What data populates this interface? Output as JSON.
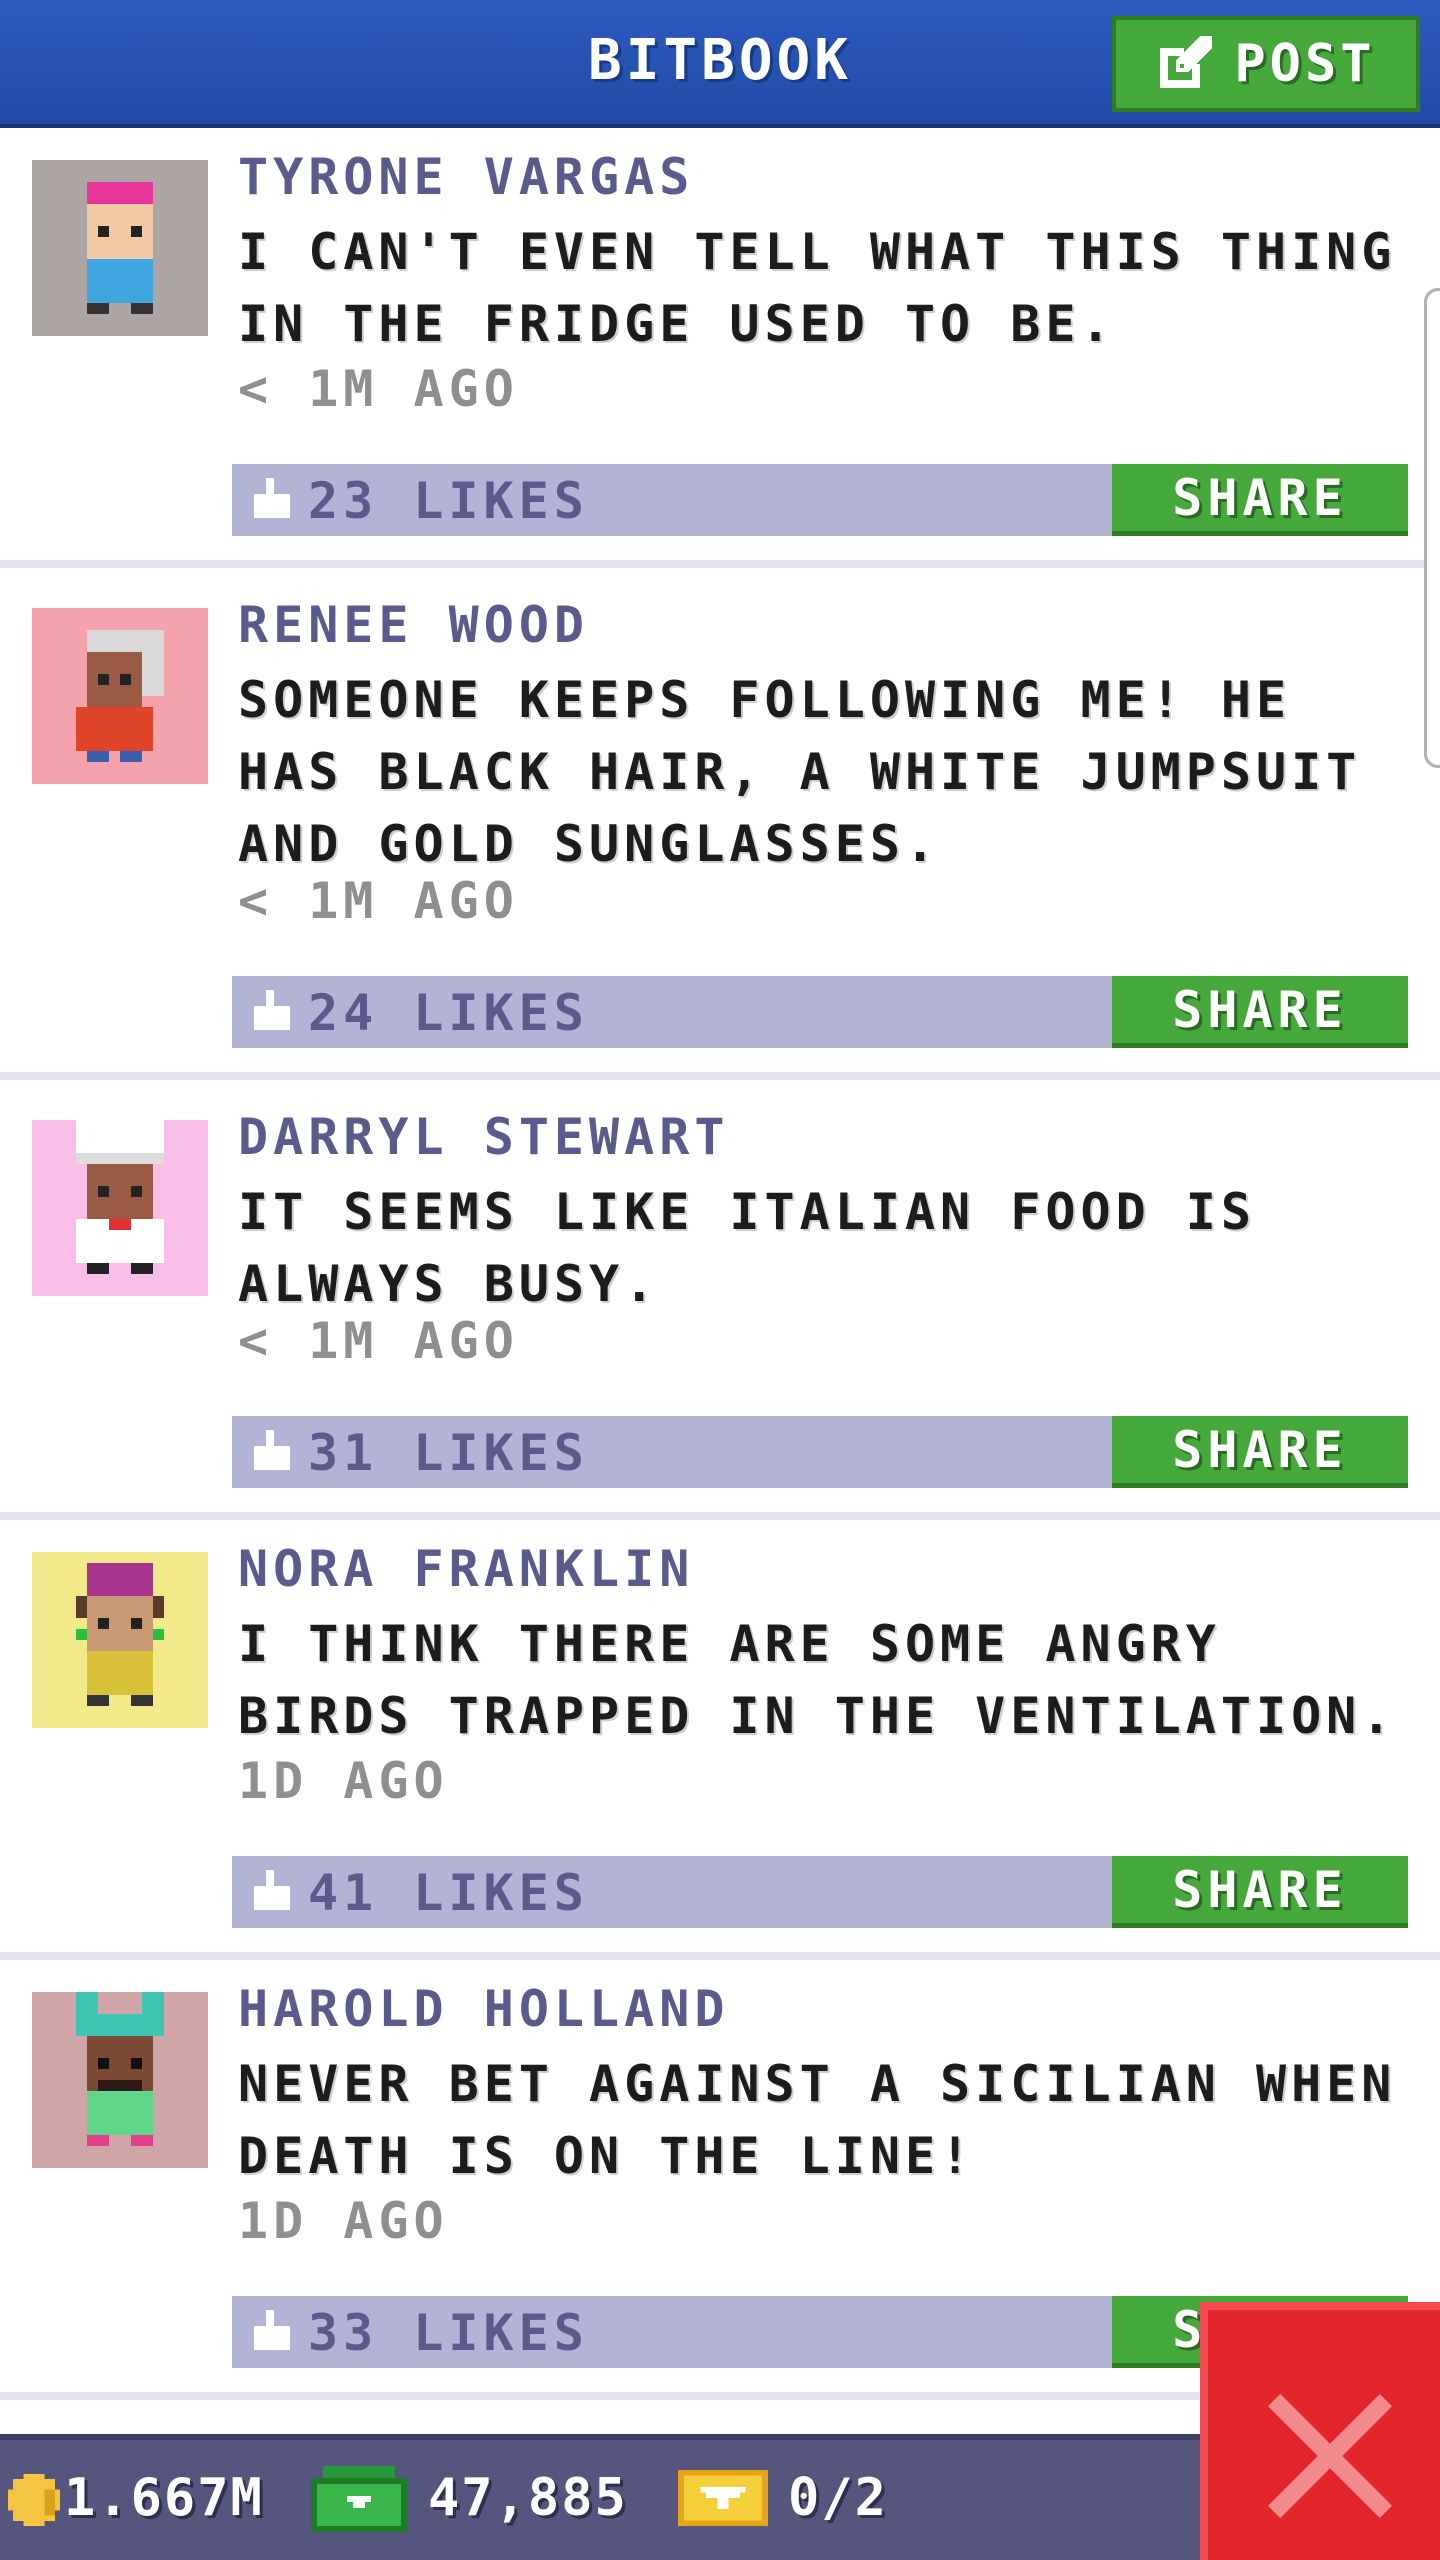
{
  "header": {
    "title": "BITBOOK",
    "post_label": "POST"
  },
  "posts": [
    {
      "author": "TYRONE VARGAS",
      "message": "I CAN'T EVEN TELL WHAT THIS THING IN THE FRIDGE USED TO BE.",
      "time": "< 1M AGO",
      "likes": "23 LIKES",
      "share_label": "SHARE",
      "avatar_bg": "#aca5a3",
      "hair": "#e8369b",
      "shirt": "#3fa6e0",
      "skin": "#f2c9a4"
    },
    {
      "author": "RENEE WOOD",
      "message": "SOMEONE KEEPS FOLLOWING ME! HE HAS BLACK HAIR, A WHITE JUMPSUIT AND GOLD SUNGLASSES.",
      "time": "< 1M AGO",
      "likes": "24 LIKES",
      "share_label": "SHARE",
      "avatar_bg": "#f4a3ac",
      "hair": "#d9d9d9",
      "shirt": "#e0452a",
      "skin": "#9a5a43"
    },
    {
      "author": "DARRYL STEWART",
      "message": "IT SEEMS LIKE ITALIAN FOOD IS ALWAYS BUSY.",
      "time": "< 1M AGO",
      "likes": "31 LIKES",
      "share_label": "SHARE",
      "avatar_bg": "#f9bfe8",
      "hair": "#ffffff",
      "shirt": "#ffffff",
      "skin": "#9a5a43"
    },
    {
      "author": "NORA FRANKLIN",
      "message": "I THINK THERE ARE SOME ANGRY BIRDS TRAPPED IN THE VENTILATION.",
      "time": "1D AGO",
      "likes": "41 LIKES",
      "share_label": "SHARE",
      "avatar_bg": "#f1e98a",
      "hair": "#a8368f",
      "shirt": "#d9c23a",
      "skin": "#c99a73"
    },
    {
      "author": "HAROLD HOLLAND",
      "message": "NEVER BET AGAINST A SICILIAN WHEN DEATH IS ON THE LINE!",
      "time": "1D AGO",
      "likes": "33 LIKES",
      "share_label": "SHARE",
      "avatar_bg": "#cfa5a7",
      "hair": "#3fc4b3",
      "shirt": "#5fd68a",
      "skin": "#7a4a35"
    }
  ],
  "footer": {
    "coins": "1.667M",
    "bux": "47,885",
    "tickets": "0/2"
  },
  "icons": {
    "post": "edit-icon",
    "like": "thumbs-up-icon",
    "coin": "coin-icon",
    "bux": "bux-icon",
    "ticket": "golden-ticket-icon",
    "close": "close-icon"
  },
  "colors": {
    "header_blue": "#2a56b8",
    "action_green": "#45a83a",
    "likes_bar": "#b3b3d6",
    "author_purple": "#5a5a8c",
    "footer": "#55557e",
    "close_red": "#e2262b"
  }
}
